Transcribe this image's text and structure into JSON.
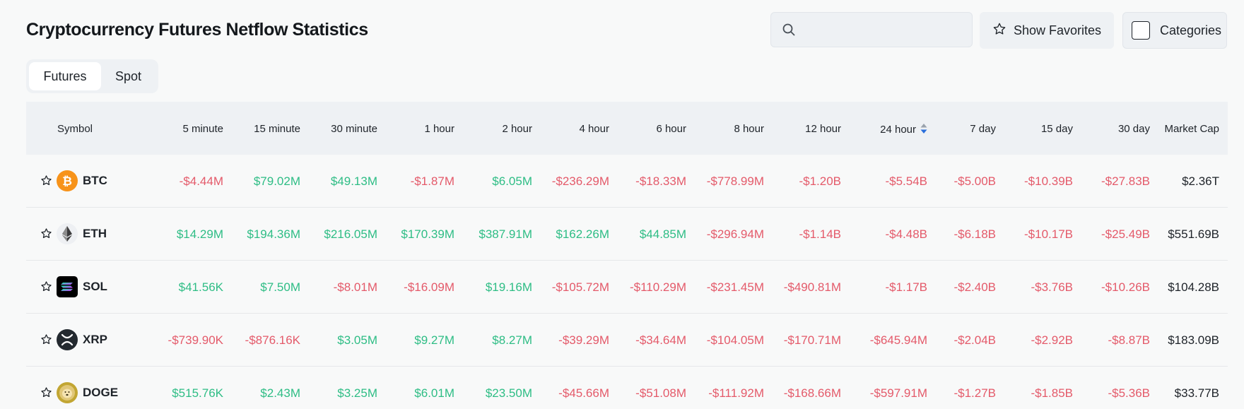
{
  "page": {
    "title": "Cryptocurrency Futures Netflow Statistics"
  },
  "search": {
    "placeholder": "",
    "value": ""
  },
  "buttons": {
    "show_favorites": "Show Favorites",
    "categories": "Categories"
  },
  "tabs": [
    {
      "label": "Futures",
      "active": true
    },
    {
      "label": "Spot",
      "active": false
    }
  ],
  "colors": {
    "positive": "#2ebd85",
    "negative": "#e45a6a",
    "sort_indicator": "#2a6fdb"
  },
  "table": {
    "columns": [
      "Symbol",
      "5 minute",
      "15 minute",
      "30 minute",
      "1 hour",
      "2 hour",
      "4 hour",
      "6 hour",
      "8 hour",
      "12 hour",
      "24 hour",
      "7 day",
      "15 day",
      "30 day",
      "Market Cap"
    ],
    "sorted_column": "24 hour",
    "rows": [
      {
        "symbol": "BTC",
        "icon": "bitcoin-icon",
        "values": [
          "-$4.44M",
          "$79.02M",
          "$49.13M",
          "-$1.87M",
          "$6.05M",
          "-$236.29M",
          "-$18.33M",
          "-$778.99M",
          "-$1.20B",
          "-$5.54B",
          "-$5.00B",
          "-$10.39B",
          "-$27.83B"
        ],
        "market_cap": "$2.36T"
      },
      {
        "symbol": "ETH",
        "icon": "ethereum-icon",
        "values": [
          "$14.29M",
          "$194.36M",
          "$216.05M",
          "$170.39M",
          "$387.91M",
          "$162.26M",
          "$44.85M",
          "-$296.94M",
          "-$1.14B",
          "-$4.48B",
          "-$6.18B",
          "-$10.17B",
          "-$25.49B"
        ],
        "market_cap": "$551.69B"
      },
      {
        "symbol": "SOL",
        "icon": "solana-icon",
        "values": [
          "$41.56K",
          "$7.50M",
          "-$8.01M",
          "-$16.09M",
          "$19.16M",
          "-$105.72M",
          "-$110.29M",
          "-$231.45M",
          "-$490.81M",
          "-$1.17B",
          "-$2.40B",
          "-$3.76B",
          "-$10.26B"
        ],
        "market_cap": "$104.28B"
      },
      {
        "symbol": "XRP",
        "icon": "xrp-icon",
        "values": [
          "-$739.90K",
          "-$876.16K",
          "$3.05M",
          "$9.27M",
          "$8.27M",
          "-$39.29M",
          "-$34.64M",
          "-$104.05M",
          "-$170.71M",
          "-$645.94M",
          "-$2.04B",
          "-$2.92B",
          "-$8.87B"
        ],
        "market_cap": "$183.09B"
      },
      {
        "symbol": "DOGE",
        "icon": "dogecoin-icon",
        "values": [
          "$515.76K",
          "$2.43M",
          "$3.25M",
          "$6.01M",
          "$23.50M",
          "-$45.66M",
          "-$51.08M",
          "-$111.92M",
          "-$168.66M",
          "-$597.91M",
          "-$1.27B",
          "-$1.85B",
          "-$5.36B"
        ],
        "market_cap": "$33.77B"
      }
    ]
  }
}
